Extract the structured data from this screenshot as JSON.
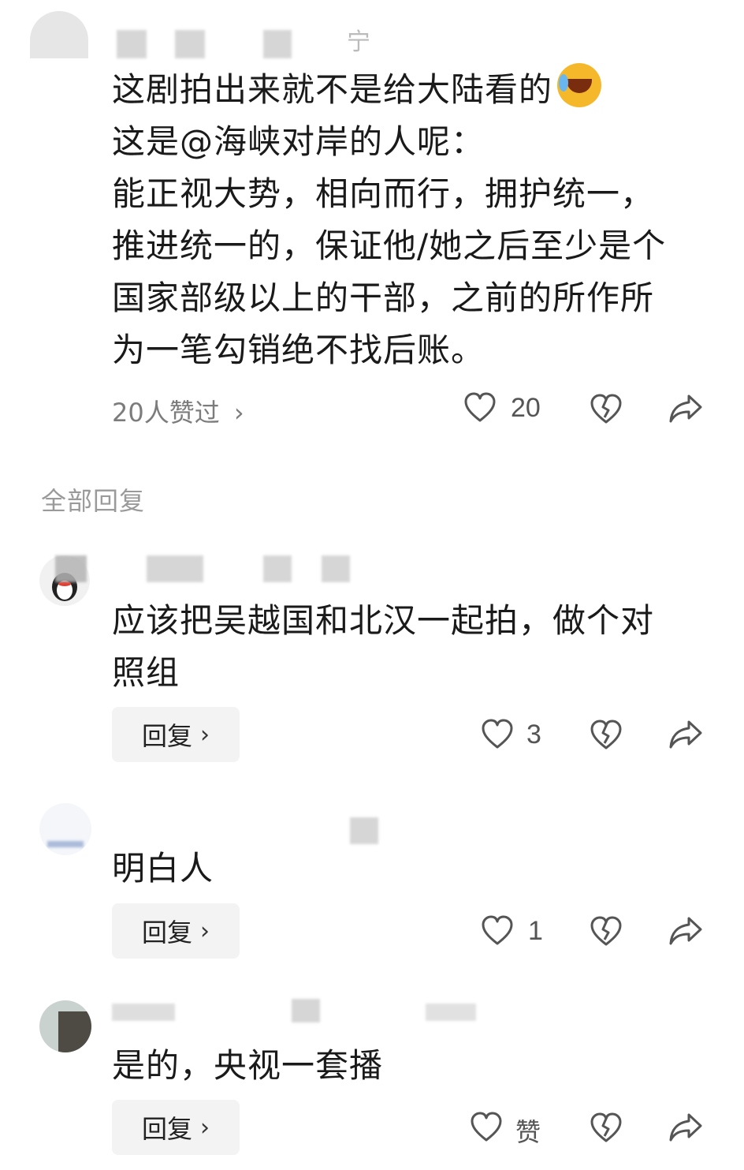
{
  "main_comment": {
    "lines": [
      "这剧拍出来就不是给大陆看的",
      "这是@海峡对岸的人呢：",
      "能正视大势，相向而行，拥护统一，",
      "推进统一的，保证他/她之后至少是个",
      "国家部级以上的干部，之前的所作所",
      "为一笔勾销绝不找后账。"
    ],
    "emoji": "laughing-crying-emoji",
    "liked_by": "20人赞过",
    "like_count": "20"
  },
  "section_title": "全部回复",
  "replies": [
    {
      "text_lines": [
        "应该把吴越国和北汉一起拍，做个对",
        "照组"
      ],
      "reply_label": "回复",
      "like_count": "3"
    },
    {
      "text_lines": [
        "明白人"
      ],
      "reply_label": "回复",
      "like_count": "1"
    },
    {
      "text_lines": [
        "是的，央视一套播"
      ],
      "reply_label": "回复",
      "like_count": "赞"
    }
  ],
  "icons": {
    "like": "heart-outline-icon",
    "dislike": "broken-heart-icon",
    "share": "share-arrow-icon",
    "chevron": "chevron-right-icon"
  },
  "colors": {
    "text": "#1a1a1a",
    "muted": "#7c7c7c",
    "button_bg": "#f3f3f3",
    "icon": "#555555"
  }
}
